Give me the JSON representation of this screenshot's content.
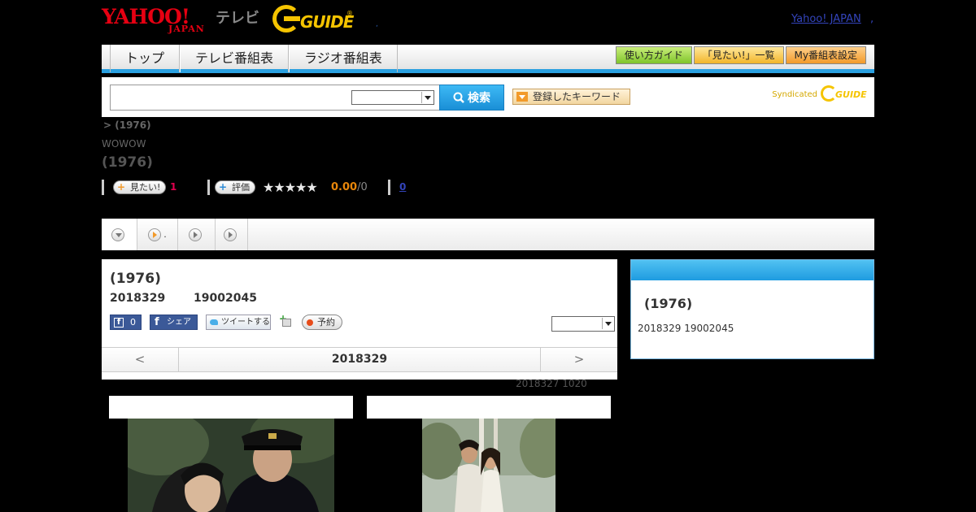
{
  "header": {
    "yahoo_logo": "YAHOO!",
    "japan_logo": "JAPAN",
    "tv_label": "テレビ",
    "gguide_logo": "GUIDE",
    "gguide_reg": "®",
    "dot": ",",
    "yahoo_japan_link": "Yahoo! JAPAN",
    "link_sep": ","
  },
  "nav": {
    "tabs": [
      {
        "label": "トップ"
      },
      {
        "label": "テレビ番組表"
      },
      {
        "label": "ラジオ番組表"
      }
    ],
    "buttons": [
      {
        "label": "使い方ガイド"
      },
      {
        "label": "「見たい!」一覧"
      },
      {
        "label": "My番組表設定"
      }
    ]
  },
  "search": {
    "input_value": "",
    "search_button": "検索",
    "keyword_button": "登録したキーワード",
    "syndicated_label": "Syndicated",
    "syndicated_logo": "GUIDE"
  },
  "program": {
    "breadcrumb": "> (1976)",
    "station": "WOWOW",
    "title": "(1976)",
    "want_label": "見たい!",
    "want_count": "1",
    "rate_label": "評価",
    "stars": "★★★★★",
    "score": "0.00",
    "score_denominator": "/0",
    "review_count": "0"
  },
  "tabbar": {
    "items": [
      {
        "label": ""
      },
      {
        "label": "."
      },
      {
        "label": ""
      },
      {
        "label": ""
      }
    ]
  },
  "detail": {
    "title": "(1976)",
    "date": "2018329",
    "time": "19002045",
    "fb_count": "0",
    "fb_icon": "f",
    "fb_share": "シェア",
    "tweet": "ツイートする",
    "gift_plus": "+",
    "reserve": "予約",
    "prev": "<",
    "current_date": "2018329",
    "next": ">",
    "updated": "2018327  1020"
  },
  "side": {
    "title": "(1976)",
    "info": "2018329  19002045"
  },
  "colors": {
    "accent_blue": "#2aa0e0",
    "yahoo_red": "#e60012",
    "gguide_yellow": "#f5c400",
    "want_pink": "#e0004e",
    "score_orange": "#e8860a"
  }
}
